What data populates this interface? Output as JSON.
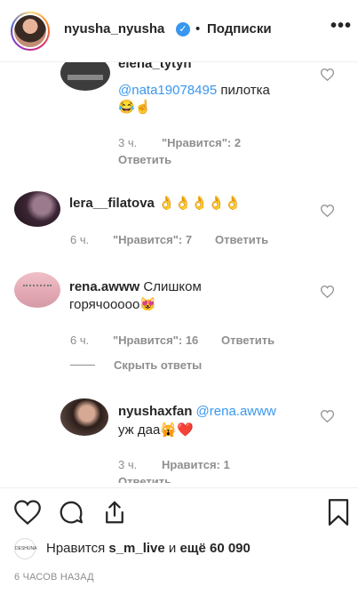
{
  "header": {
    "username": "nyusha_nyusha",
    "verified_glyph": "✓",
    "separator": "•",
    "follow_label": "Подписки",
    "more_label": "•••"
  },
  "comments": [
    {
      "username": "elena_tytyn",
      "mention": "@nata19078495",
      "text": " пилотка",
      "line2": "😂☝",
      "time": "3 ч.",
      "likes": "\"Нравится\": 2",
      "reply": "Ответить"
    },
    {
      "username": "lera__filatova",
      "text": "👌👌👌👌👌",
      "time": "6 ч.",
      "likes": "\"Нравится\": 7",
      "reply": "Ответить"
    },
    {
      "username": "rena.awww",
      "text": " Слишком",
      "line2": "горячооооо😻",
      "time": "6 ч.",
      "likes": "\"Нравится\": 16",
      "reply": "Ответить",
      "hide_replies": "Скрыть ответы"
    },
    {
      "username": "nyushaxfan",
      "mention": "@rena.awww",
      "line2": "уж даа🙀❤️",
      "time": "3 ч.",
      "likes": "Нравится: 1",
      "reply": "Ответить"
    }
  ],
  "icons": {
    "like": "heart-icon",
    "comment": "comment-icon",
    "share": "share-icon",
    "save": "bookmark-icon"
  },
  "likes_summary": {
    "avatar_text": "DESHUNA",
    "prefix": "Нравится ",
    "user": "s_m_live",
    "middle": " и ",
    "count": "ещё 60 090"
  },
  "time_ago": "6 ЧАСОВ НАЗАД",
  "colors": {
    "accent": "#3897f0",
    "muted": "#8e8e8e",
    "text": "#262626"
  }
}
